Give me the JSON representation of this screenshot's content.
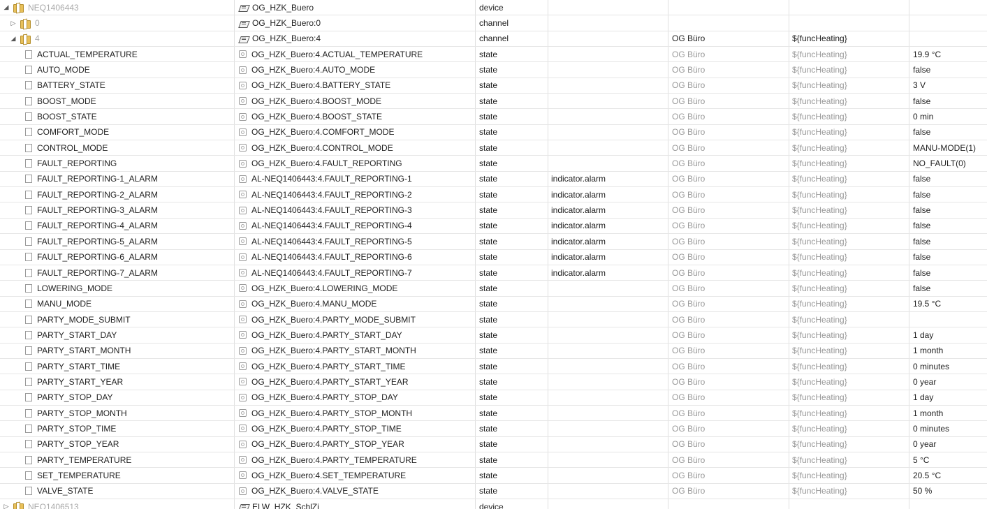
{
  "columns": [
    "name",
    "id",
    "type",
    "role",
    "room",
    "function",
    "value"
  ],
  "rows": [
    {
      "name": "NEQ1406443",
      "name_muted": true,
      "id": "OG_HZK_Buero",
      "type": "device",
      "role": "",
      "room": "",
      "func": "",
      "value": "",
      "level": 0,
      "toggle": "▲",
      "icon": "folder",
      "id_icon": "device"
    },
    {
      "name": "0",
      "name_muted": true,
      "id": "OG_HZK_Buero:0",
      "type": "channel",
      "role": "",
      "room": "",
      "func": "",
      "value": "",
      "level": 1,
      "toggle": "▷",
      "icon": "folder",
      "id_icon": "device"
    },
    {
      "name": "4",
      "name_muted": true,
      "id": "OG_HZK_Buero:4",
      "type": "channel",
      "role": "",
      "room": "OG Büro",
      "func": "${funcHeating}",
      "value": "",
      "level": 1,
      "toggle": "▲",
      "icon": "folder",
      "id_icon": "device"
    },
    {
      "name": "ACTUAL_TEMPERATURE",
      "id": "OG_HZK_Buero:4.ACTUAL_TEMPERATURE",
      "type": "state",
      "role": "",
      "room": "OG Büro",
      "func": "${funcHeating}",
      "value": "19.9 °C",
      "level": 2,
      "icon": "file",
      "id_icon": "state"
    },
    {
      "name": "AUTO_MODE",
      "id": "OG_HZK_Buero:4.AUTO_MODE",
      "type": "state",
      "role": "",
      "room": "OG Büro",
      "func": "${funcHeating}",
      "value": "false",
      "level": 2,
      "icon": "file",
      "id_icon": "state"
    },
    {
      "name": "BATTERY_STATE",
      "id": "OG_HZK_Buero:4.BATTERY_STATE",
      "type": "state",
      "role": "",
      "room": "OG Büro",
      "func": "${funcHeating}",
      "value": "3 V",
      "level": 2,
      "icon": "file",
      "id_icon": "state"
    },
    {
      "name": "BOOST_MODE",
      "id": "OG_HZK_Buero:4.BOOST_MODE",
      "type": "state",
      "role": "",
      "room": "OG Büro",
      "func": "${funcHeating}",
      "value": "false",
      "level": 2,
      "icon": "file",
      "id_icon": "state"
    },
    {
      "name": "BOOST_STATE",
      "id": "OG_HZK_Buero:4.BOOST_STATE",
      "type": "state",
      "role": "",
      "room": "OG Büro",
      "func": "${funcHeating}",
      "value": "0 min",
      "level": 2,
      "icon": "file",
      "id_icon": "state"
    },
    {
      "name": "COMFORT_MODE",
      "id": "OG_HZK_Buero:4.COMFORT_MODE",
      "type": "state",
      "role": "",
      "room": "OG Büro",
      "func": "${funcHeating}",
      "value": "false",
      "level": 2,
      "icon": "file",
      "id_icon": "state"
    },
    {
      "name": "CONTROL_MODE",
      "id": "OG_HZK_Buero:4.CONTROL_MODE",
      "type": "state",
      "role": "",
      "room": "OG Büro",
      "func": "${funcHeating}",
      "value": "MANU-MODE(1)",
      "level": 2,
      "icon": "file",
      "id_icon": "state"
    },
    {
      "name": "FAULT_REPORTING",
      "id": "OG_HZK_Buero:4.FAULT_REPORTING",
      "type": "state",
      "role": "",
      "room": "OG Büro",
      "func": "${funcHeating}",
      "value": "NO_FAULT(0)",
      "level": 2,
      "icon": "file",
      "id_icon": "state"
    },
    {
      "name": "FAULT_REPORTING-1_ALARM",
      "id": "AL-NEQ1406443:4.FAULT_REPORTING-1",
      "type": "state",
      "role": "indicator.alarm",
      "room": "OG Büro",
      "func": "${funcHeating}",
      "value": "false",
      "level": 2,
      "icon": "file",
      "id_icon": "state"
    },
    {
      "name": "FAULT_REPORTING-2_ALARM",
      "id": "AL-NEQ1406443:4.FAULT_REPORTING-2",
      "type": "state",
      "role": "indicator.alarm",
      "room": "OG Büro",
      "func": "${funcHeating}",
      "value": "false",
      "level": 2,
      "icon": "file",
      "id_icon": "state"
    },
    {
      "name": "FAULT_REPORTING-3_ALARM",
      "id": "AL-NEQ1406443:4.FAULT_REPORTING-3",
      "type": "state",
      "role": "indicator.alarm",
      "room": "OG Büro",
      "func": "${funcHeating}",
      "value": "false",
      "level": 2,
      "icon": "file",
      "id_icon": "state"
    },
    {
      "name": "FAULT_REPORTING-4_ALARM",
      "id": "AL-NEQ1406443:4.FAULT_REPORTING-4",
      "type": "state",
      "role": "indicator.alarm",
      "room": "OG Büro",
      "func": "${funcHeating}",
      "value": "false",
      "level": 2,
      "icon": "file",
      "id_icon": "state"
    },
    {
      "name": "FAULT_REPORTING-5_ALARM",
      "id": "AL-NEQ1406443:4.FAULT_REPORTING-5",
      "type": "state",
      "role": "indicator.alarm",
      "room": "OG Büro",
      "func": "${funcHeating}",
      "value": "false",
      "level": 2,
      "icon": "file",
      "id_icon": "state"
    },
    {
      "name": "FAULT_REPORTING-6_ALARM",
      "id": "AL-NEQ1406443:4.FAULT_REPORTING-6",
      "type": "state",
      "role": "indicator.alarm",
      "room": "OG Büro",
      "func": "${funcHeating}",
      "value": "false",
      "level": 2,
      "icon": "file",
      "id_icon": "state"
    },
    {
      "name": "FAULT_REPORTING-7_ALARM",
      "id": "AL-NEQ1406443:4.FAULT_REPORTING-7",
      "type": "state",
      "role": "indicator.alarm",
      "room": "OG Büro",
      "func": "${funcHeating}",
      "value": "false",
      "level": 2,
      "icon": "file",
      "id_icon": "state"
    },
    {
      "name": "LOWERING_MODE",
      "id": "OG_HZK_Buero:4.LOWERING_MODE",
      "type": "state",
      "role": "",
      "room": "OG Büro",
      "func": "${funcHeating}",
      "value": "false",
      "level": 2,
      "icon": "file",
      "id_icon": "state"
    },
    {
      "name": "MANU_MODE",
      "id": "OG_HZK_Buero:4.MANU_MODE",
      "type": "state",
      "role": "",
      "room": "OG Büro",
      "func": "${funcHeating}",
      "value": "19.5 °C",
      "level": 2,
      "icon": "file",
      "id_icon": "state"
    },
    {
      "name": "PARTY_MODE_SUBMIT",
      "id": "OG_HZK_Buero:4.PARTY_MODE_SUBMIT",
      "type": "state",
      "role": "",
      "room": "OG Büro",
      "func": "${funcHeating}",
      "value": "",
      "level": 2,
      "icon": "file",
      "id_icon": "state"
    },
    {
      "name": "PARTY_START_DAY",
      "id": "OG_HZK_Buero:4.PARTY_START_DAY",
      "type": "state",
      "role": "",
      "room": "OG Büro",
      "func": "${funcHeating}",
      "value": "1 day",
      "level": 2,
      "icon": "file",
      "id_icon": "state"
    },
    {
      "name": "PARTY_START_MONTH",
      "id": "OG_HZK_Buero:4.PARTY_START_MONTH",
      "type": "state",
      "role": "",
      "room": "OG Büro",
      "func": "${funcHeating}",
      "value": "1 month",
      "level": 2,
      "icon": "file",
      "id_icon": "state"
    },
    {
      "name": "PARTY_START_TIME",
      "id": "OG_HZK_Buero:4.PARTY_START_TIME",
      "type": "state",
      "role": "",
      "room": "OG Büro",
      "func": "${funcHeating}",
      "value": "0 minutes",
      "level": 2,
      "icon": "file",
      "id_icon": "state"
    },
    {
      "name": "PARTY_START_YEAR",
      "id": "OG_HZK_Buero:4.PARTY_START_YEAR",
      "type": "state",
      "role": "",
      "room": "OG Büro",
      "func": "${funcHeating}",
      "value": "0 year",
      "level": 2,
      "icon": "file",
      "id_icon": "state"
    },
    {
      "name": "PARTY_STOP_DAY",
      "id": "OG_HZK_Buero:4.PARTY_STOP_DAY",
      "type": "state",
      "role": "",
      "room": "OG Büro",
      "func": "${funcHeating}",
      "value": "1 day",
      "level": 2,
      "icon": "file",
      "id_icon": "state"
    },
    {
      "name": "PARTY_STOP_MONTH",
      "id": "OG_HZK_Buero:4.PARTY_STOP_MONTH",
      "type": "state",
      "role": "",
      "room": "OG Büro",
      "func": "${funcHeating}",
      "value": "1 month",
      "level": 2,
      "icon": "file",
      "id_icon": "state"
    },
    {
      "name": "PARTY_STOP_TIME",
      "id": "OG_HZK_Buero:4.PARTY_STOP_TIME",
      "type": "state",
      "role": "",
      "room": "OG Büro",
      "func": "${funcHeating}",
      "value": "0 minutes",
      "level": 2,
      "icon": "file",
      "id_icon": "state"
    },
    {
      "name": "PARTY_STOP_YEAR",
      "id": "OG_HZK_Buero:4.PARTY_STOP_YEAR",
      "type": "state",
      "role": "",
      "room": "OG Büro",
      "func": "${funcHeating}",
      "value": "0 year",
      "level": 2,
      "icon": "file",
      "id_icon": "state"
    },
    {
      "name": "PARTY_TEMPERATURE",
      "id": "OG_HZK_Buero:4.PARTY_TEMPERATURE",
      "type": "state",
      "role": "",
      "room": "OG Büro",
      "func": "${funcHeating}",
      "value": "5 °C",
      "level": 2,
      "icon": "file",
      "id_icon": "state"
    },
    {
      "name": "SET_TEMPERATURE",
      "id": "OG_HZK_Buero:4.SET_TEMPERATURE",
      "type": "state",
      "role": "",
      "room": "OG Büro",
      "func": "${funcHeating}",
      "value": "20.5 °C",
      "level": 2,
      "icon": "file",
      "id_icon": "state"
    },
    {
      "name": "VALVE_STATE",
      "id": "OG_HZK_Buero:4.VALVE_STATE",
      "type": "state",
      "role": "",
      "room": "OG Büro",
      "func": "${funcHeating}",
      "value": "50 %",
      "level": 2,
      "icon": "file",
      "id_icon": "state"
    },
    {
      "name": "NEQ1406513",
      "name_muted": true,
      "id": "ELW_HZK_SchlZi",
      "type": "device",
      "role": "",
      "room": "",
      "func": "",
      "value": "",
      "level": 0,
      "toggle": "▷",
      "icon": "folder",
      "id_icon": "device"
    }
  ]
}
